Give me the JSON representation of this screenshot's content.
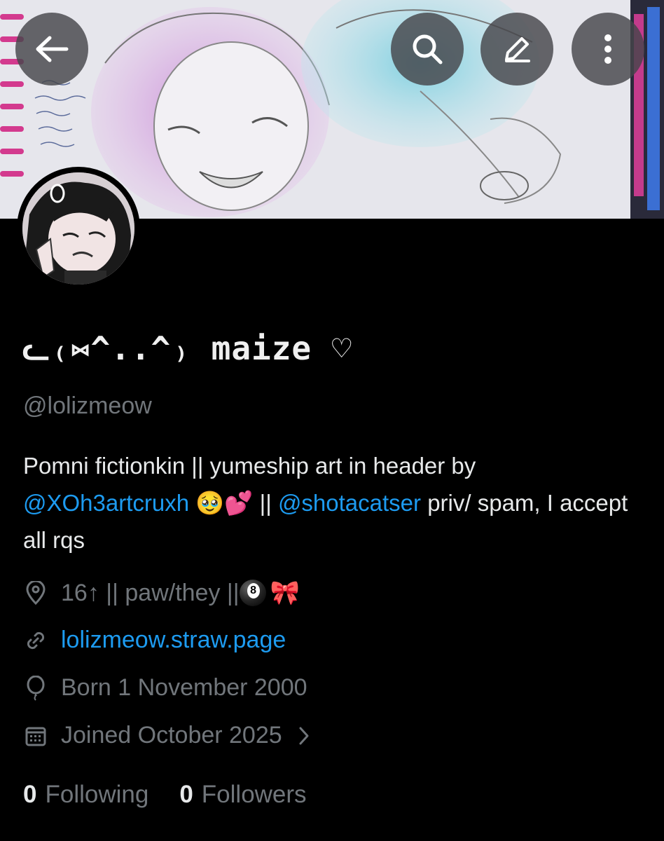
{
  "profile": {
    "display_name": "ᓚ₍⑅^..^₎ maize ♡",
    "handle": "@lolizmeow",
    "bio": {
      "text_1": "Pomni fictionkin || yumeship art in header by ",
      "mention_1": "@XOh3artcruxh",
      "emoji_1": "🥹💕",
      "text_2": " || ",
      "mention_2": "@shotacatser",
      "text_3": " priv/ spam, I accept all rqs"
    },
    "location": "16↑ || paw/they || ",
    "location_emoji": "🎀",
    "link": "lolizmeow.straw.page",
    "born": "Born 1 November 2000",
    "joined": "Joined October 2025",
    "following_count": "0",
    "following_label": "Following",
    "followers_count": "0",
    "followers_label": "Followers"
  },
  "icons": {
    "back": "arrow-left-icon",
    "search": "search-icon",
    "edit": "pencil-icon",
    "more": "more-vertical-icon",
    "location": "map-pin-icon",
    "link": "link-icon",
    "born": "balloon-icon",
    "joined": "calendar-icon"
  },
  "colors": {
    "accent": "#1d9bf0",
    "muted": "#71767b",
    "background": "#000000"
  }
}
